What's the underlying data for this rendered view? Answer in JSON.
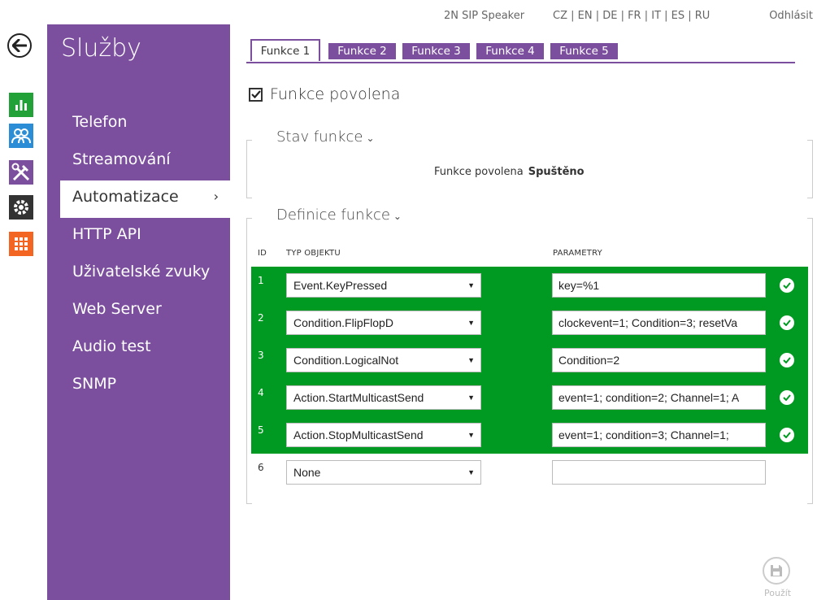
{
  "header": {
    "device_name": "2N SIP Speaker",
    "languages": "CZ | EN | DE | FR | IT | ES | RU",
    "logout": "Odhlásit"
  },
  "rail_icons": [
    {
      "name": "status-icon",
      "color": "#22a139"
    },
    {
      "name": "users-icon",
      "color": "#2b8dd6"
    },
    {
      "name": "services-icon",
      "color": "#7b4f9d"
    },
    {
      "name": "hardware-icon",
      "color": "#333333"
    },
    {
      "name": "system-icon",
      "color": "#f26522"
    }
  ],
  "sidebar": {
    "title": "Služby",
    "items": [
      {
        "label": "Telefon"
      },
      {
        "label": "Streamování"
      },
      {
        "label": "Automatizace",
        "active": true
      },
      {
        "label": "HTTP API"
      },
      {
        "label": "Uživatelské zvuky"
      },
      {
        "label": "Web Server"
      },
      {
        "label": "Audio test"
      },
      {
        "label": "SNMP"
      }
    ],
    "active_chevron": "›"
  },
  "tabs": [
    {
      "label": "Funkce 1",
      "active": true
    },
    {
      "label": "Funkce 2"
    },
    {
      "label": "Funkce 3"
    },
    {
      "label": "Funkce 4"
    },
    {
      "label": "Funkce 5"
    }
  ],
  "enabled": {
    "label": "Funkce povolena",
    "checked": true
  },
  "status_section": {
    "title": "Stav funkce",
    "label": "Funkce povolena",
    "value": "Spuštěno"
  },
  "definition_section": {
    "title": "Definice funkce",
    "columns": {
      "id": "ID",
      "type": "TYP OBJEKTU",
      "params": "PARAMETRY"
    },
    "rows": [
      {
        "id": "1",
        "type": "Event.KeyPressed",
        "params": "key=%1",
        "valid": true
      },
      {
        "id": "2",
        "type": "Condition.FlipFlopD",
        "params": "clockevent=1; Condition=3; resetVa",
        "valid": true
      },
      {
        "id": "3",
        "type": "Condition.LogicalNot",
        "params": "Condition=2",
        "valid": true
      },
      {
        "id": "4",
        "type": "Action.StartMulticastSend",
        "params": "event=1; condition=2; Channel=1; A",
        "valid": true
      },
      {
        "id": "5",
        "type": "Action.StopMulticastSend",
        "params": "event=1; condition=3; Channel=1;",
        "valid": true
      },
      {
        "id": "6",
        "type": "None",
        "params": "",
        "valid": false
      }
    ]
  },
  "save": {
    "label": "Použít"
  },
  "colors": {
    "accent": "#7b4f9d",
    "valid_row": "#009a22"
  }
}
